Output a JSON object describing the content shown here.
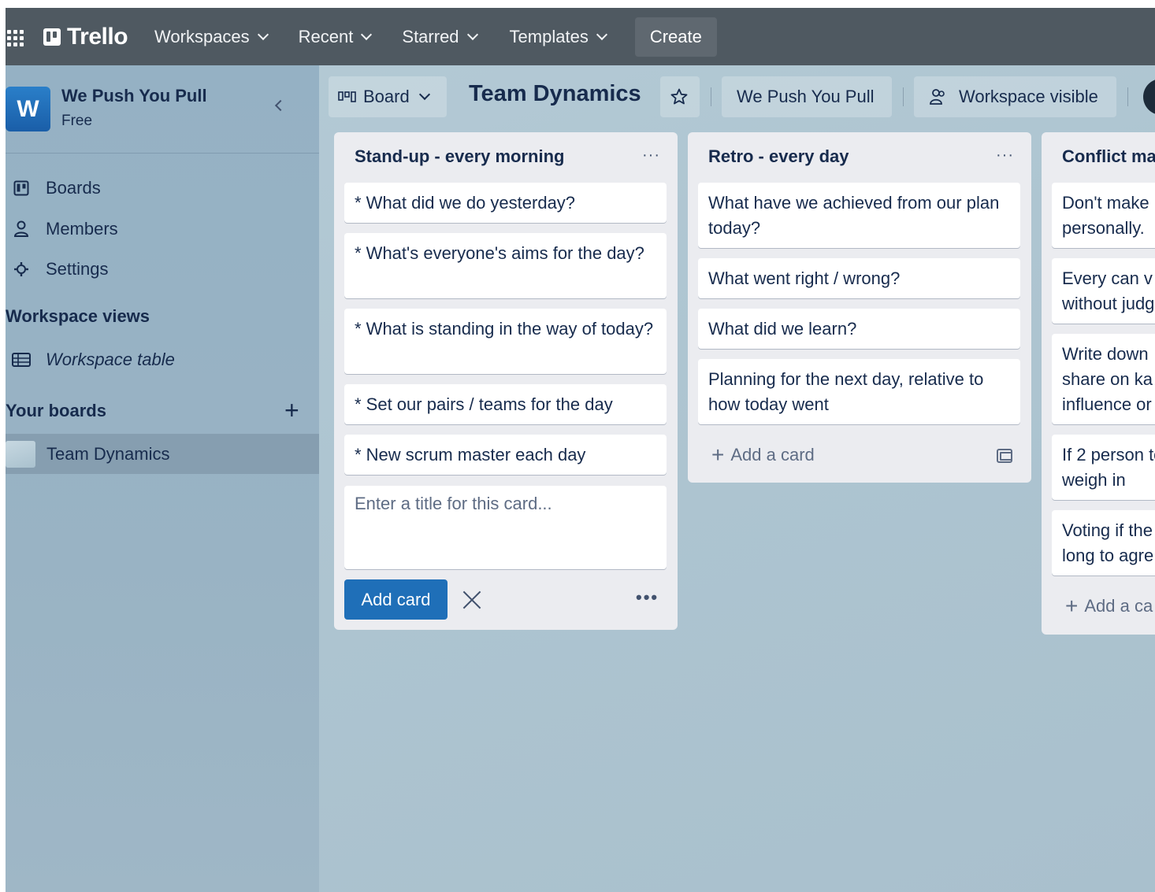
{
  "topnav": {
    "logo": "Trello",
    "items": [
      {
        "label": "Workspaces"
      },
      {
        "label": "Recent"
      },
      {
        "label": "Starred"
      },
      {
        "label": "Templates"
      }
    ],
    "create_label": "Create"
  },
  "sidebar": {
    "workspace_initial": "W",
    "workspace_name": "We Push You Pull",
    "workspace_plan": "Free",
    "items": [
      {
        "label": "Boards",
        "icon": "board-icon"
      },
      {
        "label": "Members",
        "icon": "person-icon"
      },
      {
        "label": "Settings",
        "icon": "gear-icon"
      }
    ],
    "views_heading": "Workspace views",
    "views": [
      {
        "label": "Workspace table",
        "icon": "table-icon"
      }
    ],
    "boards_heading": "Your boards",
    "add_board_symbol": "+",
    "boards": [
      {
        "label": "Team Dynamics"
      }
    ]
  },
  "board": {
    "view_label": "Board",
    "title": "Team Dynamics",
    "workspace_label": "We Push You Pull",
    "visibility_label": "Workspace visible"
  },
  "lists": [
    {
      "title": "Stand-up - every morning",
      "cards": [
        "* What did we do yesterday?",
        "* What's everyone's aims for the day?",
        "* What is standing in the way of today?",
        "* Set our pairs / teams for the day",
        "* New scrum master each day"
      ],
      "composer_placeholder": "Enter a title for this card...",
      "add_card_button": "Add card"
    },
    {
      "title": "Retro - every day",
      "cards": [
        "What have we achieved from our plan today?",
        "What went right / wrong?",
        "What did we learn?",
        "Planning for the next day, relative to how today went"
      ],
      "add_card_link": "Add a card"
    },
    {
      "title": "Conflict ma",
      "cards": [
        "Don't make personally.",
        "Every can v without judg",
        "Write down share on ka influence or",
        "If 2 person to weigh in",
        "Voting if the long to agre"
      ],
      "add_card_link": "Add a ca"
    }
  ],
  "colors": {
    "topnav_bg": "#4f5961",
    "primary_button": "#1f6fb8",
    "list_bg": "#ebecf0"
  }
}
